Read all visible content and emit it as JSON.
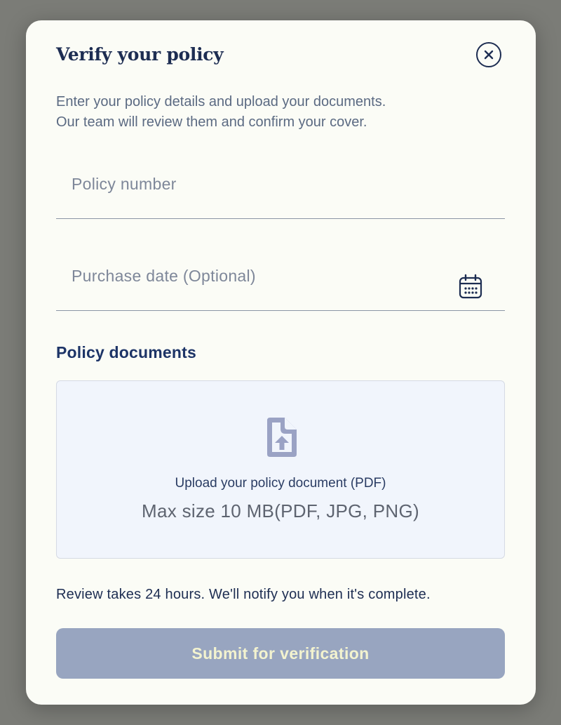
{
  "modal": {
    "title": "Verify your policy",
    "intro_line1": "Enter your policy details and upload your documents.",
    "intro_line2": "Our team will review them and confirm your cover."
  },
  "fields": {
    "policy_number": {
      "placeholder": "Policy number",
      "value": ""
    },
    "purchase_date": {
      "placeholder": "Purchase date (Optional)",
      "value": ""
    }
  },
  "documents": {
    "label": "Policy documents",
    "upload_title": "Upload your policy document (PDF)",
    "upload_meta": "Max size 10 MB(PDF, JPG, PNG)"
  },
  "notice": "Review takes 24 hours. We'll notify you when it's complete.",
  "submit_label": "Submit for verification",
  "icons": {
    "close": "close-icon",
    "calendar": "calendar-icon",
    "upload": "file-upload-icon"
  },
  "colors": {
    "primary": "#1d2d52",
    "submit_disabled": "#98a5c0",
    "submit_text": "#f3f3cf",
    "dropzone_bg": "#f1f5fc",
    "backdrop": "#7b7c77"
  }
}
